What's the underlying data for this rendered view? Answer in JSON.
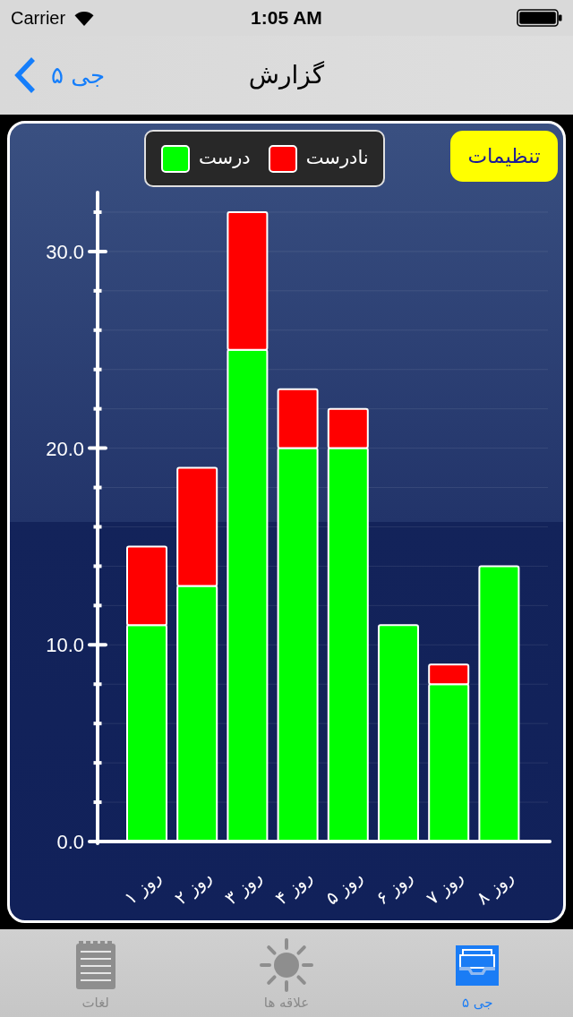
{
  "status_bar": {
    "carrier": "Carrier",
    "time": "1:05 AM"
  },
  "nav_bar": {
    "back_label": "جی ۵",
    "title": "گزارش"
  },
  "settings_button": {
    "label": "تنظیمات"
  },
  "chart": {
    "chart_data": {
      "type": "bar",
      "stacked": true,
      "grid": true,
      "categories": [
        "روز ۱",
        "روز ۲",
        "روز ۳",
        "روز ۴",
        "روز ۵",
        "روز ۶",
        "روز ۷",
        "روز ۸"
      ],
      "series": [
        {
          "name": "درست",
          "color": "#00ff00",
          "values": [
            11,
            13,
            25,
            20,
            20,
            11,
            8,
            14
          ]
        },
        {
          "name": "نادرست",
          "color": "#ff0000",
          "values": [
            4,
            6,
            7,
            3,
            2,
            0,
            1,
            0
          ]
        }
      ],
      "ylim": [
        0,
        33
      ],
      "yticks": [
        {
          "value": 0,
          "label": "0.0"
        },
        {
          "value": 10,
          "label": "10.0"
        },
        {
          "value": 20,
          "label": "20.0"
        },
        {
          "value": 30,
          "label": "30.0"
        }
      ]
    }
  },
  "tab_bar": {
    "tabs": [
      {
        "label": "جی ۵",
        "selected": true
      },
      {
        "label": "علاقه ها",
        "selected": false
      },
      {
        "label": "لغات",
        "selected": false
      }
    ]
  }
}
